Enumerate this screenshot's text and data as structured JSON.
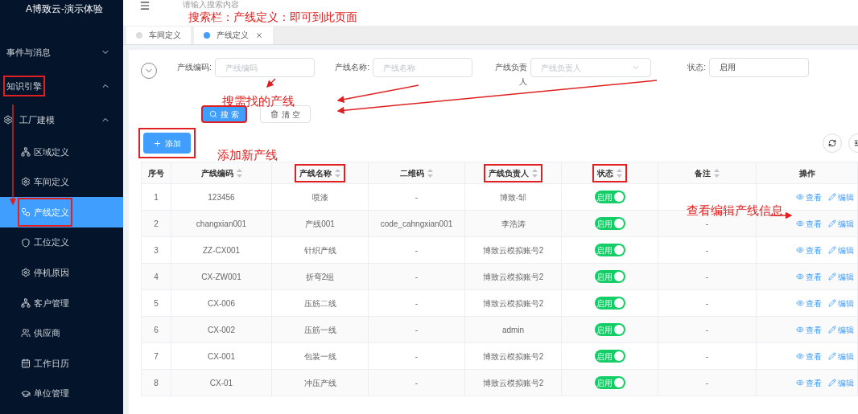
{
  "app_title": "A博致云-演示体验",
  "header": {
    "search_placeholder": "请输入搜索内容"
  },
  "sidebar": {
    "items": [
      {
        "label": "事件与消息",
        "expanded": false,
        "selected": false,
        "highlighted": false
      },
      {
        "label": "知识引擎",
        "expanded": true,
        "selected": false,
        "highlighted": true
      },
      {
        "label": "工厂建模",
        "expanded": true,
        "selected": false,
        "highlighted": false,
        "children": [
          {
            "label": "区域定义",
            "selected": false,
            "highlighted": false
          },
          {
            "label": "车间定义",
            "selected": false,
            "highlighted": false
          },
          {
            "label": "产线定义",
            "selected": true,
            "highlighted": true
          },
          {
            "label": "工位定义",
            "selected": false,
            "highlighted": false
          },
          {
            "label": "停机原因",
            "selected": false,
            "highlighted": false
          },
          {
            "label": "客户管理",
            "selected": false,
            "highlighted": false
          },
          {
            "label": "供应商",
            "selected": false,
            "highlighted": false
          },
          {
            "label": "工作日历",
            "selected": false,
            "highlighted": false
          },
          {
            "label": "单位管理",
            "selected": false,
            "highlighted": false
          }
        ]
      }
    ]
  },
  "tabs": [
    {
      "label": "车间定义",
      "selected": false,
      "closable": false
    },
    {
      "label": "产线定义",
      "selected": true,
      "closable": true
    }
  ],
  "filters": [
    {
      "label": "产线编码:",
      "placeholder": "产线编码",
      "kind": "text"
    },
    {
      "label": "产线名称:",
      "placeholder": "产线名称",
      "kind": "text"
    },
    {
      "label": "产线负责人",
      "placeholder": "产线负责人",
      "kind": "select"
    },
    {
      "label": "状态:",
      "value": "启用",
      "kind": "text"
    }
  ],
  "search_button": "搜 索",
  "clear_button": "清 空",
  "add_button": "添加",
  "table": {
    "columns": [
      {
        "label": "序号",
        "sortable": false,
        "highlighted": false
      },
      {
        "label": "产线编码",
        "sortable": true,
        "highlighted": false
      },
      {
        "label": "产线名称",
        "sortable": true,
        "highlighted": true
      },
      {
        "label": "二维码",
        "sortable": true,
        "highlighted": false
      },
      {
        "label": "产线负责人",
        "sortable": true,
        "highlighted": true
      },
      {
        "label": "状态",
        "sortable": true,
        "highlighted": true
      },
      {
        "label": "备注",
        "sortable": true,
        "highlighted": false
      },
      {
        "label": "操作",
        "sortable": false,
        "highlighted": false
      }
    ],
    "rows": [
      {
        "no": "1",
        "code": "123456",
        "name": "喷漆",
        "qr": "-",
        "owner": "博致-邹",
        "status": {
          "label": "启用",
          "on": true
        },
        "note": "",
        "actions": [
          "查看",
          "编辑"
        ]
      },
      {
        "no": "2",
        "code": "changxian001",
        "name": "产线001",
        "qr": "code_cahngxian001",
        "owner": "李浩涛",
        "status": {
          "label": "启用",
          "on": true
        },
        "note": "-",
        "actions": [
          "查看",
          "编辑"
        ]
      },
      {
        "no": "3",
        "code": "ZZ-CX001",
        "name": "针织产线",
        "qr": "-",
        "owner": "博致云模拟账号2",
        "status": {
          "label": "启用",
          "on": true
        },
        "note": "-",
        "actions": [
          "查看",
          "编辑"
        ]
      },
      {
        "no": "4",
        "code": "CX-ZW001",
        "name": "折弯2组",
        "qr": "-",
        "owner": "博致云模拟账号2",
        "status": {
          "label": "启用",
          "on": true
        },
        "note": "-",
        "actions": [
          "查看",
          "编辑"
        ]
      },
      {
        "no": "5",
        "code": "CX-006",
        "name": "压筋二线",
        "qr": "-",
        "owner": "博致云模拟账号2",
        "status": {
          "label": "启用",
          "on": true
        },
        "note": "-",
        "actions": [
          "查看",
          "编辑"
        ]
      },
      {
        "no": "6",
        "code": "CX-002",
        "name": "压筋一线",
        "qr": "-",
        "owner": "admin",
        "status": {
          "label": "启用",
          "on": true
        },
        "note": "-",
        "actions": [
          "查看",
          "编辑"
        ]
      },
      {
        "no": "7",
        "code": "CX-001",
        "name": "包装一线",
        "qr": "-",
        "owner": "博致云模拟账号2",
        "status": {
          "label": "启用",
          "on": true
        },
        "note": "-",
        "actions": [
          "查看",
          "编辑"
        ]
      },
      {
        "no": "8",
        "code": "CX-01",
        "name": "冲压产线",
        "qr": "-",
        "owner": "博致云模拟账号2",
        "status": {
          "label": "启用",
          "on": true
        },
        "note": "-",
        "actions": [
          "查看",
          "编辑"
        ]
      }
    ]
  },
  "annotations": [
    {
      "text": "搜索栏：产线定义：即可到此页面"
    },
    {
      "text": "搜需找的产线"
    },
    {
      "text": "添加新产线"
    },
    {
      "text": "查看编辑产线信息"
    }
  ]
}
